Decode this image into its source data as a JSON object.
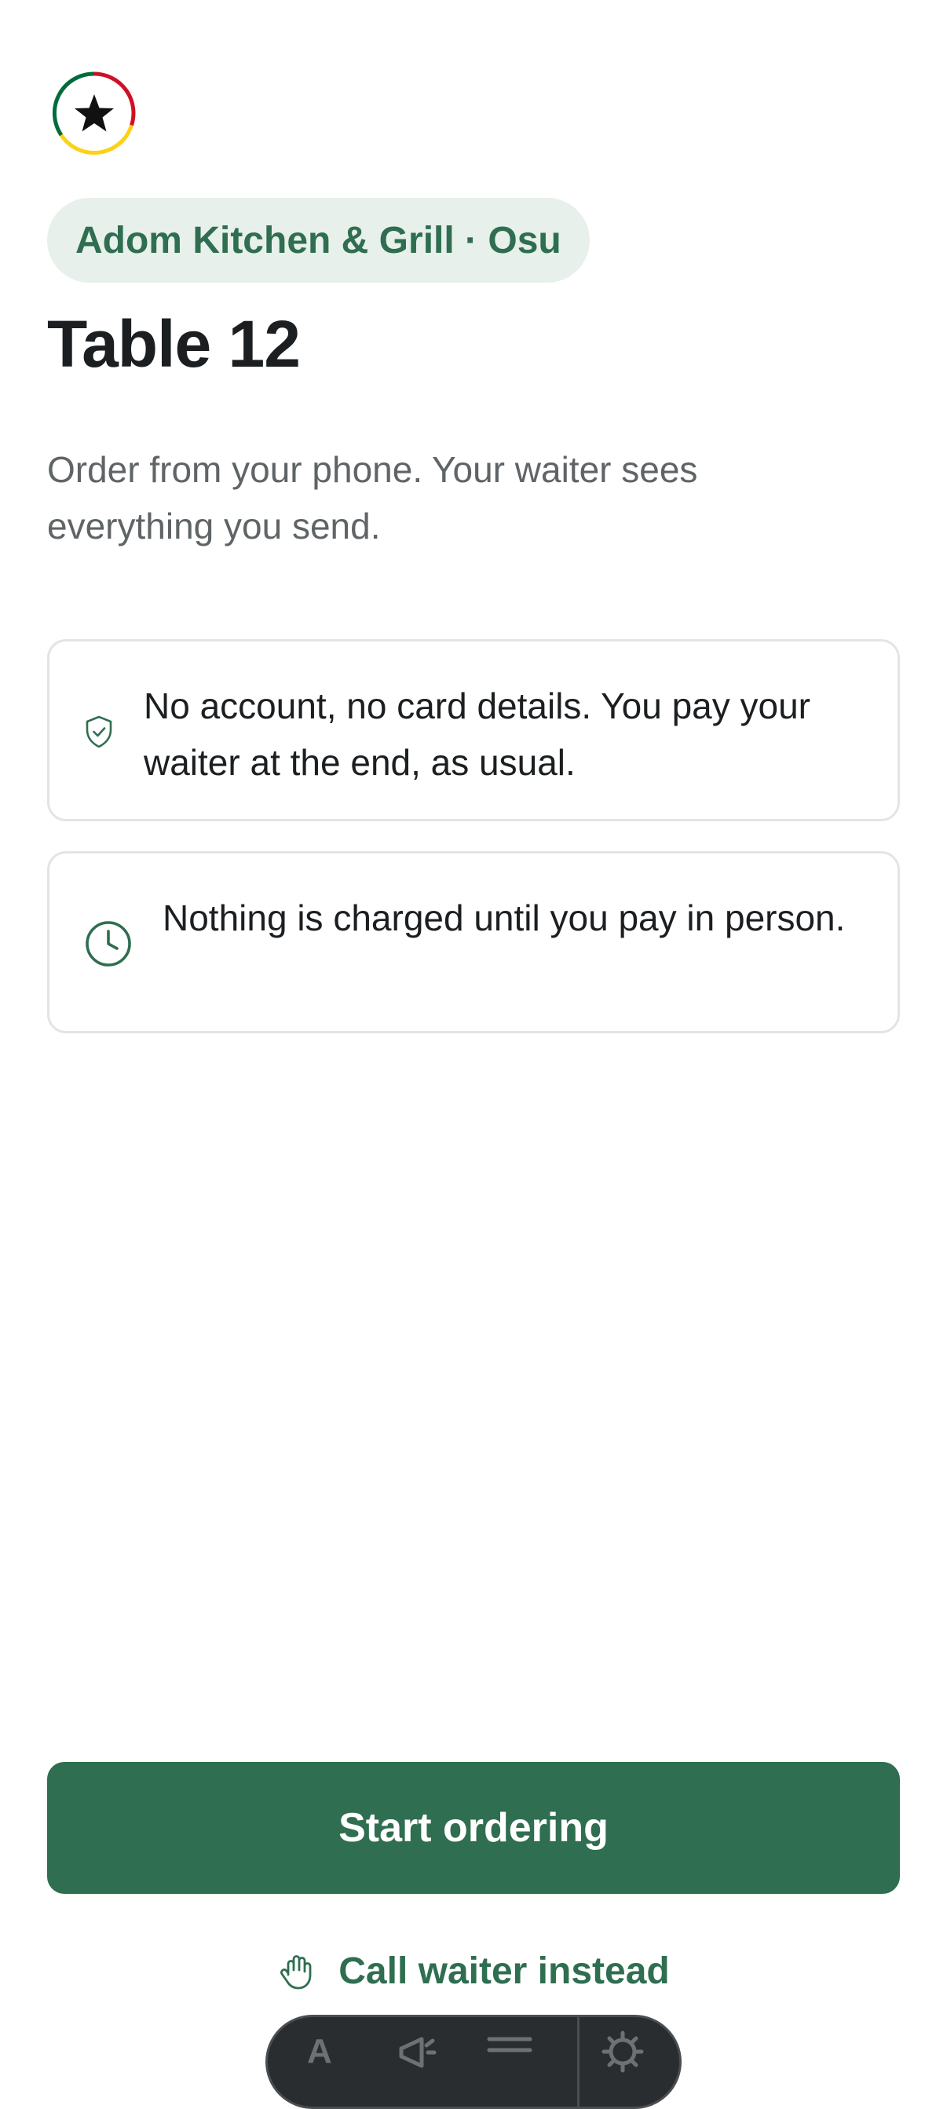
{
  "brand": {
    "logo_icon": "black-star-badge-icon",
    "colors": {
      "ring_red": "#ce1126",
      "ring_yellow": "#fcd116",
      "ring_green": "#006b3f",
      "star": "#111111"
    }
  },
  "restaurant": {
    "label": "Adom Kitchen & Grill · Osu"
  },
  "table": {
    "title": "Table 12"
  },
  "intro": {
    "text": "Order from your phone. Your waiter sees everything you send."
  },
  "info_cards": [
    {
      "icon": "shield-check-icon",
      "text": "No account, no card details. You pay your waiter at the end, as usual."
    },
    {
      "icon": "clock-icon",
      "text": "Nothing is charged until you pay in person."
    }
  ],
  "actions": {
    "primary_label": "Start ordering",
    "secondary_label": "Call waiter instead",
    "secondary_icon": "hand-icon"
  },
  "theme": {
    "accent": "#2f6e50",
    "accent_soft": "#e7f0ea",
    "text_primary": "#1c1f21",
    "text_secondary": "#5f6466",
    "border": "#e2e5e6"
  },
  "dock": {
    "items": [
      {
        "icon": "text-format-icon",
        "label": "A"
      },
      {
        "icon": "megaphone-icon"
      },
      {
        "icon": "menu-lines-icon"
      },
      {
        "icon": "gear-icon"
      }
    ]
  }
}
